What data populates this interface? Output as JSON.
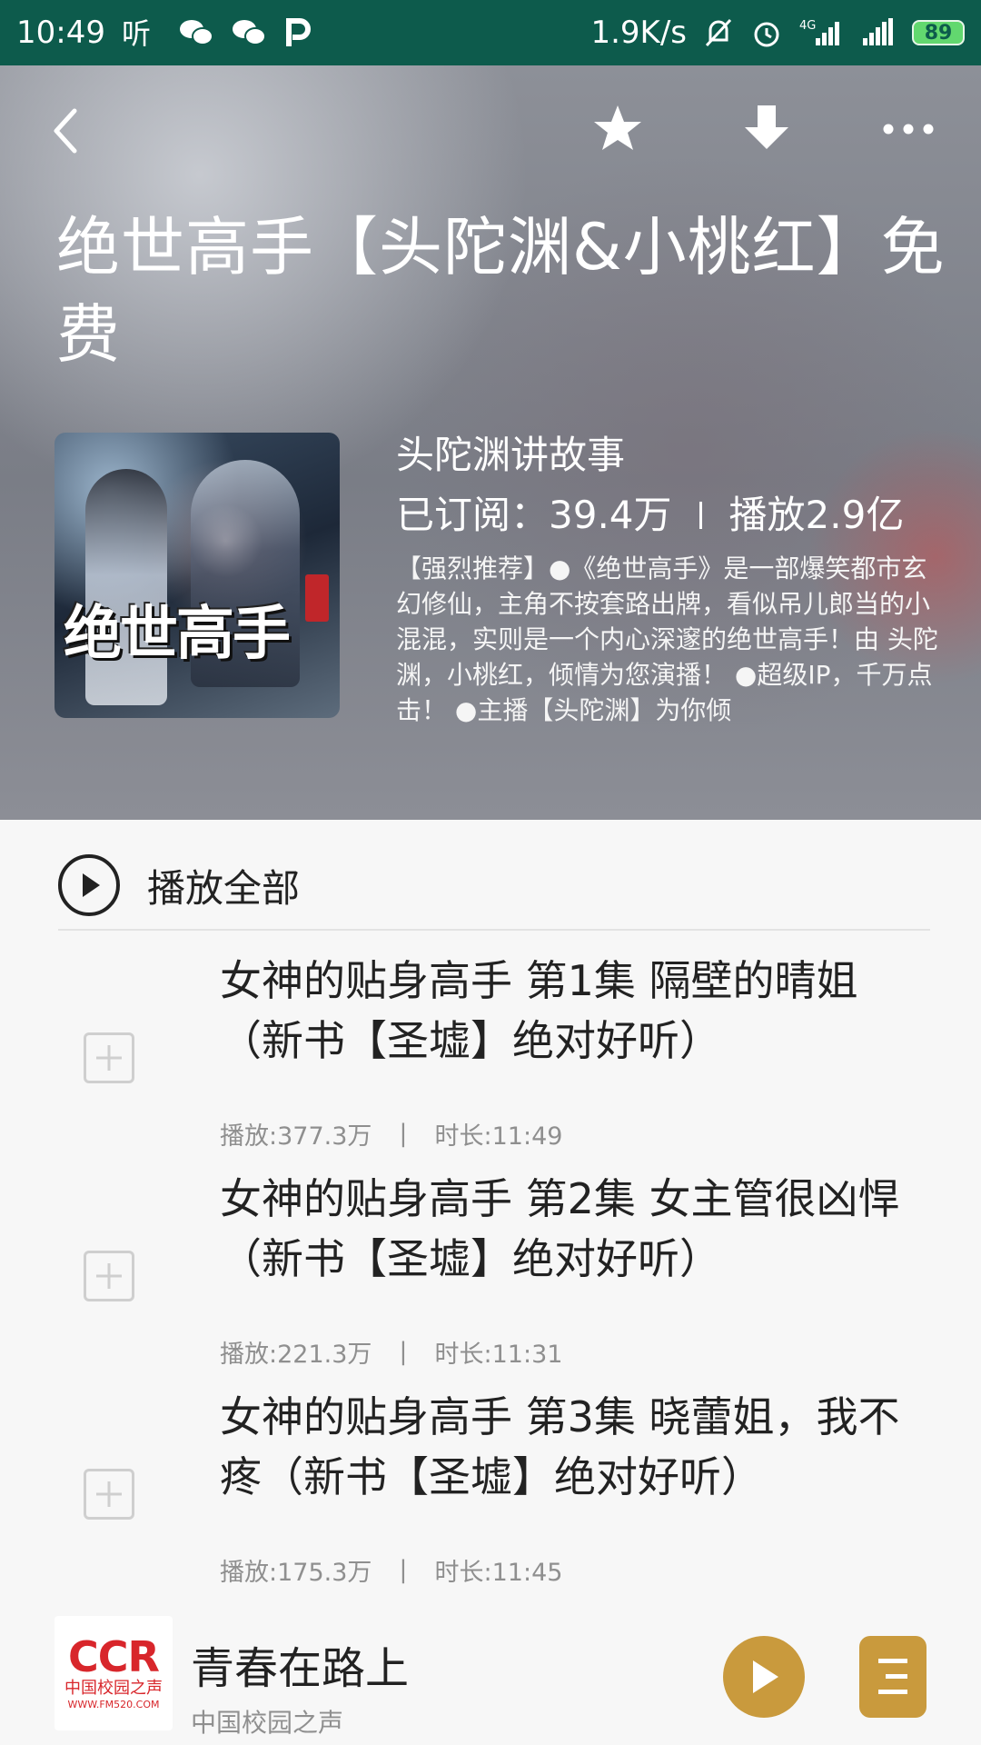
{
  "status_bar": {
    "time": "10:49",
    "net_speed": "1.9K/s",
    "battery": "89",
    "network_type": "4G",
    "left_icons": [
      "ting-app-icon",
      "wechat-icon",
      "wechat-icon",
      "p-app-icon"
    ],
    "right_icons": [
      "mute-bell-icon",
      "alarm-icon",
      "signal-icon",
      "signal-icon",
      "battery-icon"
    ]
  },
  "header": {
    "title": "绝世高手【头陀渊&小桃红】免费",
    "cover_text": "绝世高手",
    "anchor": "头陀渊讲故事",
    "subscribed": "已订阅：39.4万",
    "plays": "播放2.9亿",
    "description": "【强烈推荐】●《绝世高手》是一部爆笑都市玄幻修仙，主角不按套路出牌，看似吊儿郎当的小混混，实则是一个内心深邃的绝世高手！由 头陀渊，小桃红，倾情为您演播！ ●超级IP，千万点击！ ●主播【头陀渊】为你倾"
  },
  "actions": {
    "play_all": "播放全部"
  },
  "episodes": [
    {
      "title": "女神的贴身高手 第1集 隔壁的晴姐（新书【圣墟】绝对好听）",
      "plays": "播放:377.3万",
      "separator": "|",
      "duration": "时长:11:49"
    },
    {
      "title": "女神的贴身高手 第2集 女主管很凶悍（新书【圣墟】绝对好听）",
      "plays": "播放:221.3万",
      "separator": "|",
      "duration": "时长:11:31"
    },
    {
      "title": "女神的贴身高手 第3集 晓蕾姐，我不疼（新书【圣墟】绝对好听）",
      "plays": "播放:175.3万",
      "separator": "|",
      "duration": "时长:11:45"
    }
  ],
  "mini_player": {
    "logo_main": "CCR",
    "logo_sub": "中国校园之声",
    "logo_url": "WWW.FM520.COM",
    "title": "青春在路上",
    "subtitle": "中国校园之声"
  },
  "colors": {
    "status_bar": "#0d5b4c",
    "accent_gold": "#c99a3d",
    "logo_red": "#d8262b"
  }
}
